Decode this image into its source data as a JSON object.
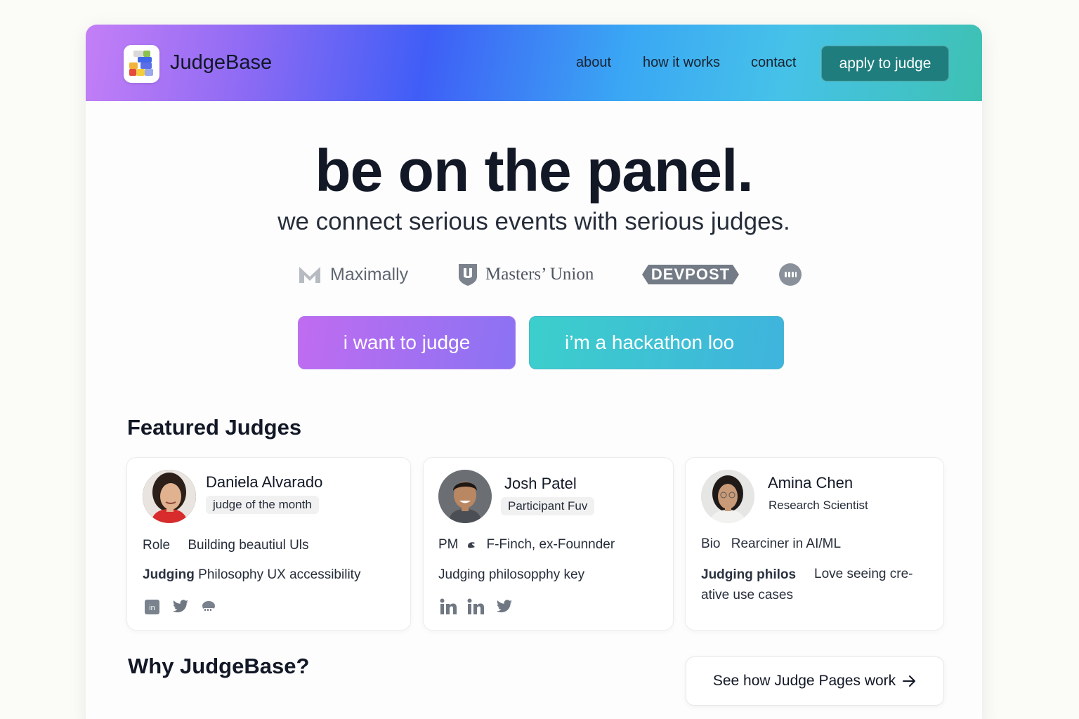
{
  "brand": {
    "name": "JudgeBase"
  },
  "nav": {
    "links": [
      "about",
      "how it works",
      "contact"
    ],
    "apply_label": "apply to judge"
  },
  "hero": {
    "title": "be on the panel.",
    "subtitle": "we connect serious events with serious judges."
  },
  "partners": [
    "Maximally",
    "Masters’ Union",
    "DEVPOST"
  ],
  "cta": {
    "judge_label": "i want to judge",
    "host_label": "i’m a hackathon loo"
  },
  "featured": {
    "title": "Featured Judges",
    "judges": [
      {
        "name": "Daniela Alvarado",
        "badge": "judge of the month",
        "role_label": "Role",
        "role_value": "Building beautiul Uls",
        "philosophy_label": "Judging",
        "philosophy_value": "Philosophy UX accessibility"
      },
      {
        "name": "Josh Patel",
        "badge": "Participant Fuv",
        "role_label": "PM",
        "role_value": "F-Finch, ex-Founnder",
        "philosophy_value": "Judging philosopphy key"
      },
      {
        "name": "Amina Chen",
        "subtitle": "Research Scientist",
        "bio_label": "Bio",
        "bio_value": "Rearciner in AI/ML",
        "philosophy_label": "Judging philos",
        "philosophy_value_line1": "Love seeing cre-",
        "philosophy_value_line2": "ative use cases"
      }
    ]
  },
  "why": {
    "title": "Why JudgeBase?",
    "how_button_label": "See how Judge Pages work"
  },
  "colors": {
    "apply_button": "#1f7d7d",
    "cta_judge_start": "#c06cf0",
    "cta_judge_end": "#8a73f3",
    "cta_host_start": "#3ccfcb",
    "cta_host_end": "#3fb3dd"
  },
  "icons": [
    "linkedin-icon",
    "twitter-icon",
    "discord-icon",
    "arrow-right-icon"
  ]
}
